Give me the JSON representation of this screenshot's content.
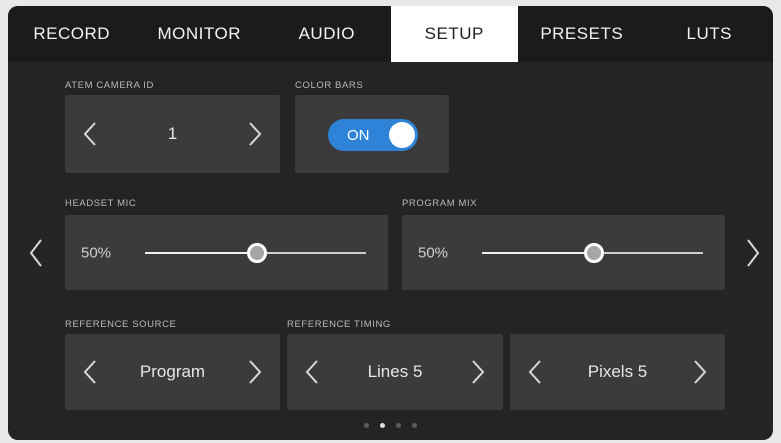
{
  "tabs": [
    {
      "label": "RECORD",
      "active": false
    },
    {
      "label": "MONITOR",
      "active": false
    },
    {
      "label": "AUDIO",
      "active": false
    },
    {
      "label": "SETUP",
      "active": true
    },
    {
      "label": "PRESETS",
      "active": false
    },
    {
      "label": "LUTS",
      "active": false
    }
  ],
  "atem_camera_id": {
    "label": "ATEM CAMERA ID",
    "value": "1"
  },
  "color_bars": {
    "label": "COLOR BARS",
    "state": "ON",
    "on_color": "#2e83d8"
  },
  "headset_mic": {
    "label": "HEADSET MIC",
    "value_text": "50%",
    "level": 0.5
  },
  "program_mix": {
    "label": "PROGRAM MIX",
    "value_text": "50%",
    "level": 0.5
  },
  "reference_source": {
    "label": "REFERENCE SOURCE",
    "value": "Program"
  },
  "reference_timing": {
    "label": "REFERENCE TIMING",
    "lines": "Lines 5",
    "pixels": "Pixels 5"
  },
  "page_dots": {
    "count": 4,
    "active_index": 1
  },
  "icons": {
    "left": "chevron-left-icon",
    "right": "chevron-right-icon"
  }
}
